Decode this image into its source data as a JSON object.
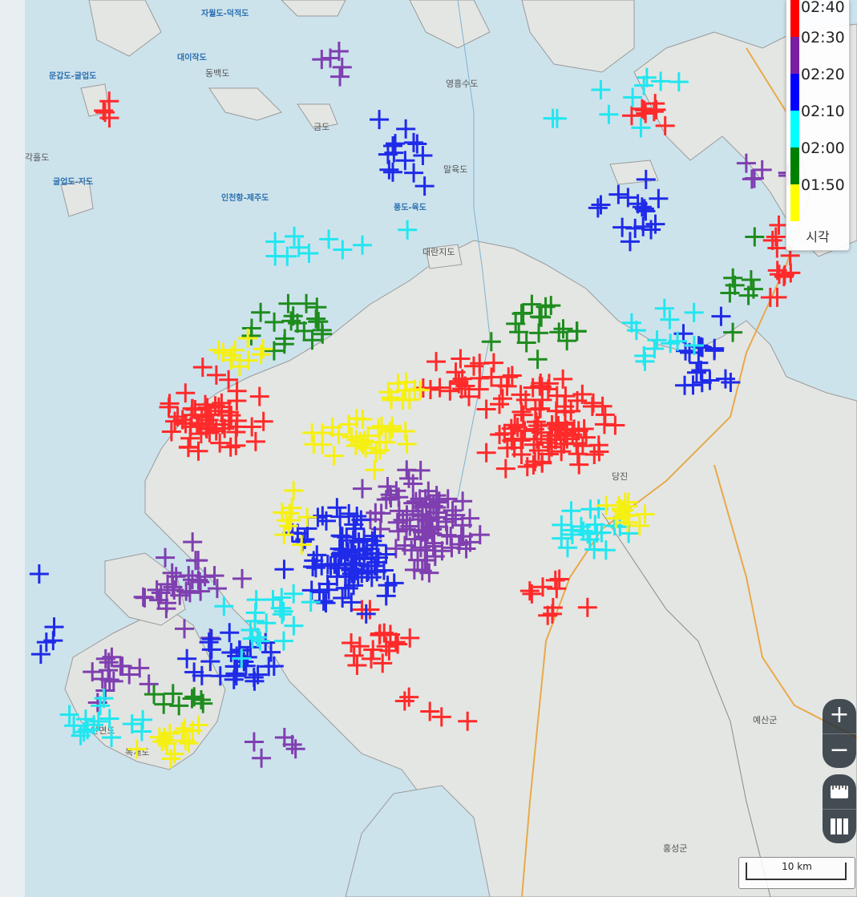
{
  "legend": {
    "title": "시각",
    "items": [
      {
        "label": "02:40",
        "color": "#ff0000"
      },
      {
        "label": "02:30",
        "color": "#7a1fa2"
      },
      {
        "label": "02:20",
        "color": "#0000ff"
      },
      {
        "label": "02:10",
        "color": "#00ffff"
      },
      {
        "label": "02:00",
        "color": "#008000"
      },
      {
        "label": "01:50",
        "color": "#ffff00"
      }
    ]
  },
  "map": {
    "place_labels": {
      "jawoldo": "자월도-덕적도",
      "mungapdo_gulupdo": "문갑도-굴업도",
      "daeido": "대이작도",
      "dongbaekdo": "동백도",
      "geumdo": "금도",
      "gakhuldo": "각흘도",
      "gulupdo_jido": "굴업도-지도",
      "incheon_jeju": "인천항-제주도",
      "yeongheungsudo": "영흥수도",
      "malyukdo": "말육도",
      "pungdo_yukdo": "풍도-육도",
      "daenanjido": "대란지도",
      "dangjin": "당진",
      "yesan": "예산군",
      "hongseong": "홍성군",
      "mokgaedo": "목개도",
      "anmyeondo": "안면도"
    }
  },
  "controls": {
    "zoom_in": "+",
    "zoom_out": "−"
  },
  "scale": {
    "label": "10 km"
  },
  "lightning_colors": {
    "t0240": "#ff2a2a",
    "t0230": "#7f3fb0",
    "t0220": "#1f2be8",
    "t0210": "#22e6f0",
    "t0200": "#1e8c1e",
    "t0150": "#f5f012"
  }
}
